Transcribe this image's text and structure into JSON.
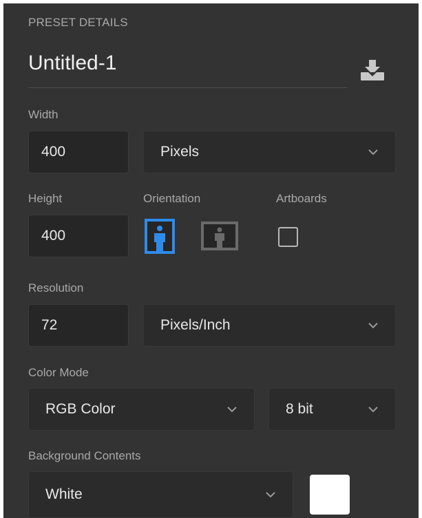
{
  "preset": {
    "section_title": "PRESET DETAILS",
    "name": "Untitled-1",
    "save_icon": "save-preset-icon"
  },
  "width": {
    "label": "Width",
    "value": "400",
    "unit": "Pixels"
  },
  "height": {
    "label": "Height",
    "value": "400"
  },
  "orientation": {
    "label": "Orientation",
    "selected": "portrait",
    "options": [
      "portrait",
      "landscape"
    ]
  },
  "artboards": {
    "label": "Artboards",
    "checked": false
  },
  "resolution": {
    "label": "Resolution",
    "value": "72",
    "unit": "Pixels/Inch"
  },
  "color_mode": {
    "label": "Color Mode",
    "mode": "RGB Color",
    "depth": "8 bit"
  },
  "background": {
    "label": "Background Contents",
    "value": "White",
    "swatch_color": "#ffffff"
  },
  "colors": {
    "panel_bg": "#333333",
    "field_bg": "#262626",
    "accent": "#2d8ceb"
  }
}
